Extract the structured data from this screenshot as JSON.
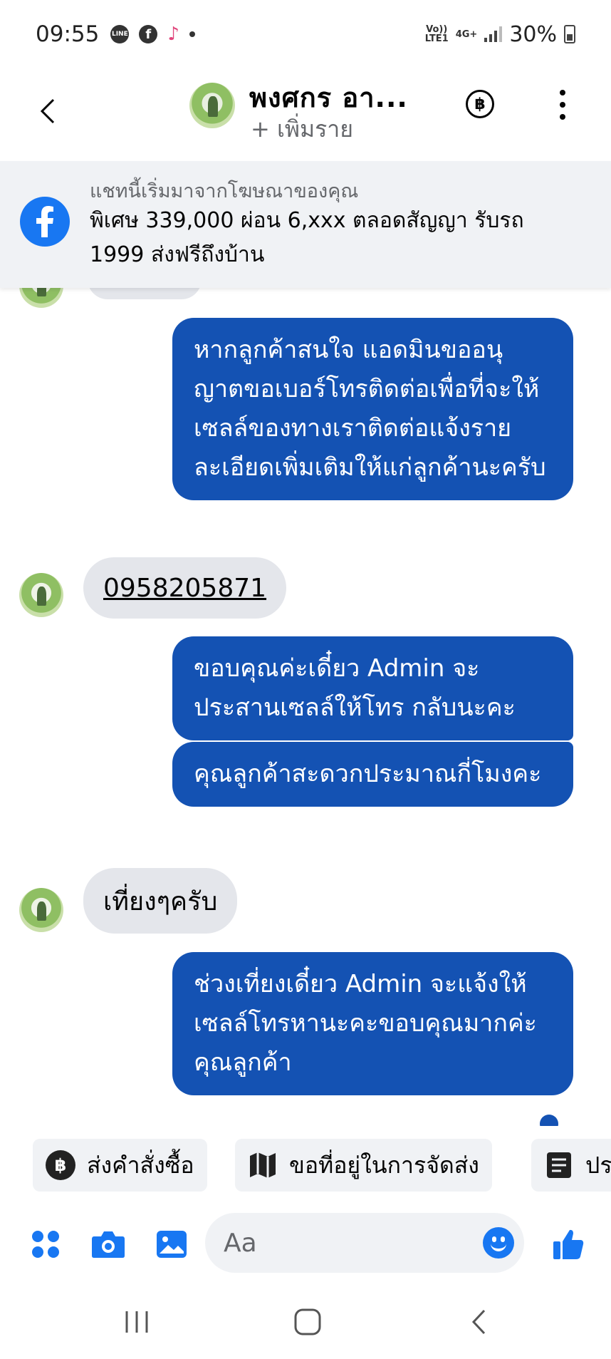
{
  "status_bar": {
    "time": "09:55",
    "network_top": "Vo))",
    "network_bottom": "LTE1",
    "net_type": "4G+",
    "battery": "30%"
  },
  "header": {
    "contact_name": "พงศกร อา...",
    "add_people": "+ เพิ่มราย"
  },
  "ad_banner": {
    "source": "แชทนี้เริ่มมาจากโฆษณาของคุณ",
    "text": "พิเศษ 339,000 ผ่อน 6,xxx ตลอดสัญญา รับรถ 1999 ส่งฟรีถึงบ้าน"
  },
  "messages": [
    {
      "side": "out",
      "text": "หากลูกค้าสนใจ แอดมินขออนุญาตขอเบอร์โทรติดต่อเพื่อที่จะให้เซลล์ของทางเราติดต่อแจ้งรายละเอียดเพิ่มเติมให้แก่ลูกค้านะครับ"
    },
    {
      "side": "in",
      "text": "0958205871"
    },
    {
      "side": "out",
      "text": "ขอบคุณค่ะเดี๋ยว Admin จะประสานเซลล์ให้โทร กลับนะคะ"
    },
    {
      "side": "out",
      "text": "คุณลูกค้าสะดวกประมาณกี่โมงคะ"
    },
    {
      "side": "in",
      "text": "เที่ยงๆครับ"
    },
    {
      "side": "out",
      "text": "ช่วงเที่ยงเดี๋ยว Admin จะแจ้งให้เซลล์โทรหานะคะขอบคุณมากค่ะคุณลูกค้า"
    }
  ],
  "quick_replies": [
    {
      "label": "ส่งคำสั่งซื้อ",
      "icon": "baht-circle-icon"
    },
    {
      "label": "ขอที่อยู่ในการจัดส่ง",
      "icon": "map-icon"
    },
    {
      "label": "ปร",
      "icon": "receipt-icon"
    }
  ],
  "composer": {
    "placeholder": "Aa"
  },
  "colors": {
    "outgoing_bubble": "#1452b3",
    "incoming_bubble": "#e4e6eb",
    "accent": "#1877f2"
  }
}
